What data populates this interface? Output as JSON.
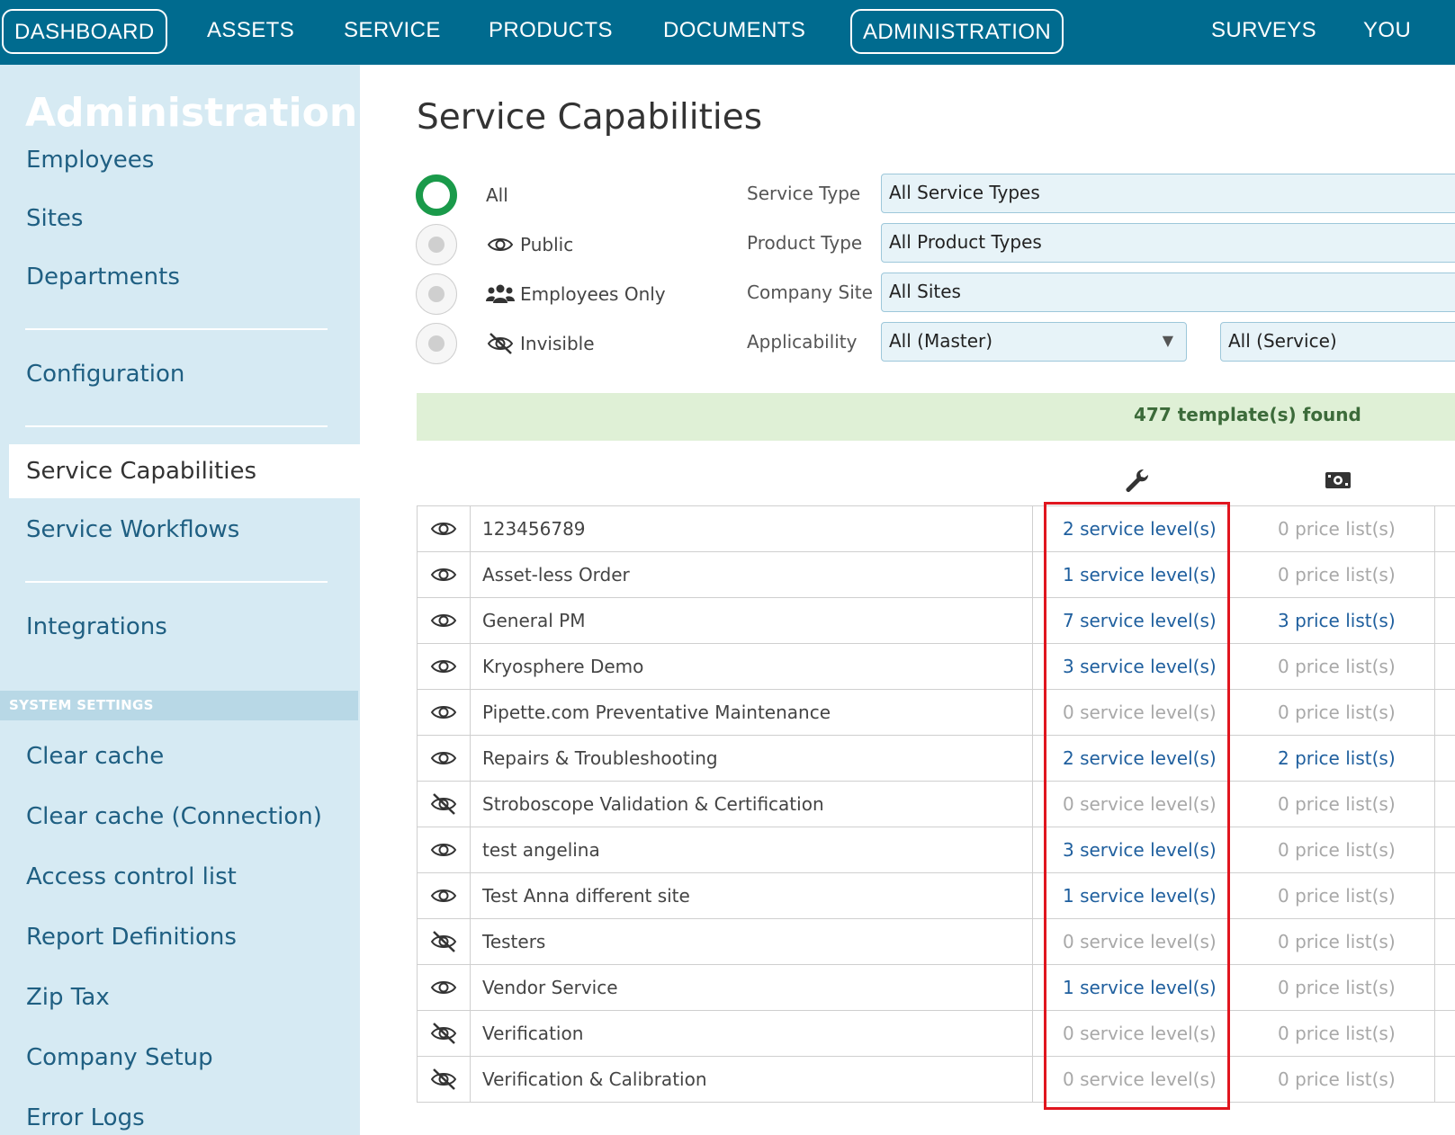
{
  "topnav": {
    "items": [
      "DASHBOARD",
      "ASSETS",
      "SERVICE",
      "PRODUCTS",
      "DOCUMENTS",
      "ADMINISTRATION",
      "SURVEYS",
      "YOU"
    ]
  },
  "sidebar": {
    "title": "Administration",
    "items": [
      "Employees",
      "Sites",
      "Departments",
      "Configuration",
      "Service Capabilities",
      "Service Workflows",
      "Integrations"
    ],
    "section_label": "SYSTEM SETTINGS",
    "settings_items": [
      "Clear cache",
      "Clear cache (Connection)",
      "Access control list",
      "Report Definitions",
      "Zip Tax",
      "Company Setup",
      "Error Logs"
    ],
    "active_item": "Service Capabilities"
  },
  "main": {
    "title": "Service Capabilities",
    "visibility_filter": {
      "options": [
        "All",
        "Public",
        "Employees Only",
        "Invisible"
      ],
      "selected": "All",
      "option_icons": [
        "",
        "eye-icon",
        "people-icon",
        "eye-slash-icon"
      ]
    },
    "filters": {
      "service_type_label": "Service Type",
      "service_type_value": "All Service Types",
      "product_type_label": "Product Type",
      "product_type_value": "All Product Types",
      "company_site_label": "Company Site",
      "company_site_value": "All Sites",
      "applicability_label": "Applicability",
      "applicability_master": "All (Master)",
      "applicability_service": "All (Service)"
    },
    "result_count": "477 template(s) found",
    "column_icons": [
      "wrench-icon",
      "money-icon"
    ],
    "rows": [
      {
        "visibility": "visible",
        "name": "123456789",
        "service_levels": "2 service level(s)",
        "price_lists": "0 price list(s)"
      },
      {
        "visibility": "visible",
        "name": "Asset-less Order",
        "service_levels": "1 service level(s)",
        "price_lists": "0 price list(s)"
      },
      {
        "visibility": "visible",
        "name": "General PM",
        "service_levels": "7 service level(s)",
        "price_lists": "3 price list(s)"
      },
      {
        "visibility": "visible",
        "name": "Kryosphere Demo",
        "service_levels": "3 service level(s)",
        "price_lists": "0 price list(s)"
      },
      {
        "visibility": "visible",
        "name": "Pipette.com Preventative Maintenance",
        "service_levels": "0 service level(s)",
        "price_lists": "0 price list(s)"
      },
      {
        "visibility": "visible",
        "name": "Repairs & Troubleshooting",
        "service_levels": "2 service level(s)",
        "price_lists": "2 price list(s)"
      },
      {
        "visibility": "invisible",
        "name": "Stroboscope Validation & Certification",
        "service_levels": "0 service level(s)",
        "price_lists": "0 price list(s)"
      },
      {
        "visibility": "visible",
        "name": "test angelina",
        "service_levels": "3 service level(s)",
        "price_lists": "0 price list(s)"
      },
      {
        "visibility": "visible",
        "name": "Test Anna different site",
        "service_levels": "1 service level(s)",
        "price_lists": "0 price list(s)"
      },
      {
        "visibility": "invisible",
        "name": "Testers",
        "service_levels": "0 service level(s)",
        "price_lists": "0 price list(s)"
      },
      {
        "visibility": "visible",
        "name": "Vendor Service",
        "service_levels": "1 service level(s)",
        "price_lists": "0 price list(s)"
      },
      {
        "visibility": "invisible",
        "name": "Verification",
        "service_levels": "0 service level(s)",
        "price_lists": "0 price list(s)"
      },
      {
        "visibility": "invisible",
        "name": "Verification & Calibration",
        "service_levels": "0 service level(s)",
        "price_lists": "0 price list(s)"
      }
    ]
  },
  "colors": {
    "nav_bg": "#006b8f",
    "sidebar_bg": "#d6eaf3",
    "link": "#1f5f9e",
    "muted": "#a8a8a8",
    "found_bar": "#dff0d6",
    "radio_selected": "#1a9a4a",
    "highlight": "#e0161f"
  }
}
